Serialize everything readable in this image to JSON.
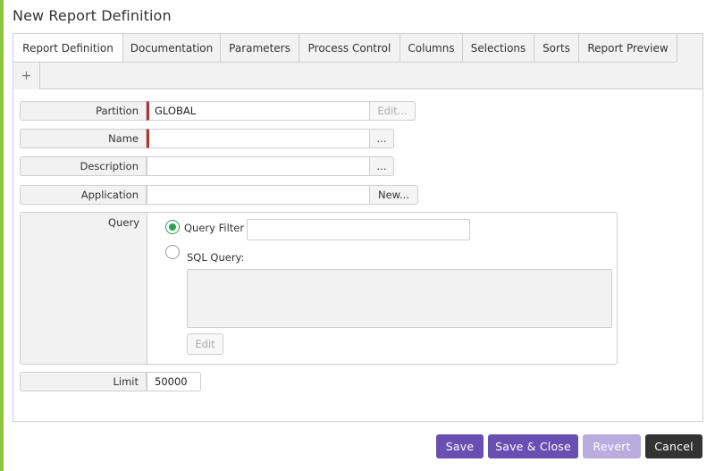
{
  "window": {
    "title": "New Report Definition"
  },
  "tabs": [
    {
      "label": "Report Definition",
      "active": true
    },
    {
      "label": "Documentation"
    },
    {
      "label": "Parameters"
    },
    {
      "label": "Process Control"
    },
    {
      "label": "Columns"
    },
    {
      "label": "Selections"
    },
    {
      "label": "Sorts"
    },
    {
      "label": "Report Preview"
    }
  ],
  "add_tab": {
    "label": "+"
  },
  "form": {
    "partition": {
      "label": "Partition",
      "value": "GLOBAL",
      "button": "Edit...",
      "required": true,
      "button_disabled": true
    },
    "name": {
      "label": "Name",
      "value": "",
      "button": "...",
      "required": true
    },
    "description": {
      "label": "Description",
      "value": "",
      "button": "..."
    },
    "application": {
      "label": "Application",
      "value": "",
      "button": "New..."
    },
    "query": {
      "label": "Query",
      "filter_option": {
        "label": "Query Filter",
        "selected": true,
        "value": ""
      },
      "sql_option": {
        "label": "SQL Query:",
        "selected": false,
        "value": ""
      },
      "edit_button": "Edit",
      "edit_disabled": true
    },
    "limit": {
      "label": "Limit",
      "value": "50000"
    }
  },
  "footer": {
    "save": "Save",
    "save_close": "Save & Close",
    "revert": "Revert",
    "cancel": "Cancel"
  },
  "colors": {
    "accent_green": "#8dc63f",
    "primary": "#6a4fb3",
    "primary_disabled": "#b9ade0",
    "dark": "#333333",
    "required_marker": "#b5322c",
    "radio_selected": "#2e9e58"
  }
}
